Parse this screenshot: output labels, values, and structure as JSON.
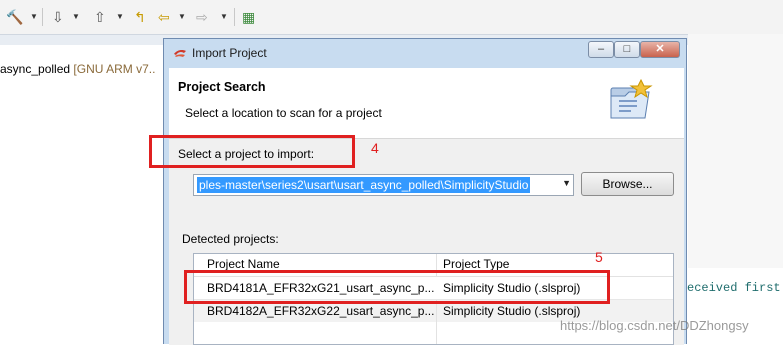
{
  "background": {
    "tree_item": {
      "name": "async_polled",
      "meta": "[GNU ARM v7.."
    },
    "console_snippet": "eceived first"
  },
  "dialog": {
    "title": "Import Project",
    "window_buttons": {
      "minimize": "–",
      "maximize": "□",
      "close": "✕"
    },
    "page_title": "Project Search",
    "page_subtitle": "Select a location to scan for a project",
    "select_label": "Select a project to import:",
    "project_path": "ples-master\\series2\\usart\\usart_async_polled\\SimplicityStudio",
    "browse_label": "Browse...",
    "detected_label": "Detected projects:",
    "table": {
      "columns": [
        "Project Name",
        "Project Type"
      ],
      "rows": [
        {
          "name": "BRD4181A_EFR32xG21_usart_async_p...",
          "type": "Simplicity Studio (.slsproj)"
        },
        {
          "name": "BRD4182A_EFR32xG22_usart_async_p...",
          "type": "Simplicity Studio (.slsproj)"
        }
      ]
    }
  },
  "annotations": {
    "step_4": "4",
    "step_5": "5"
  },
  "watermark": "https://blog.csdn.net/DDZhongsy",
  "colors": {
    "annotation_red": "#e02020",
    "selection_blue": "#3399ff",
    "dialog_frame": "#c8dcf0"
  }
}
